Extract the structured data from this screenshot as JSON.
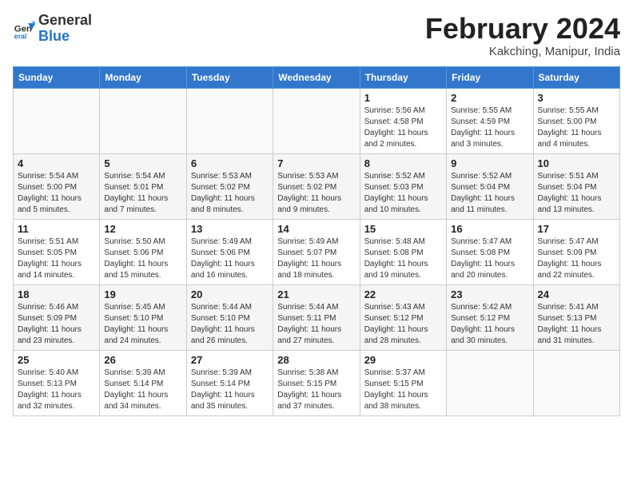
{
  "header": {
    "logo_general": "General",
    "logo_blue": "Blue",
    "month_title": "February 2024",
    "location": "Kakching, Manipur, India"
  },
  "weekdays": [
    "Sunday",
    "Monday",
    "Tuesday",
    "Wednesday",
    "Thursday",
    "Friday",
    "Saturday"
  ],
  "weeks": [
    [
      {
        "day": "",
        "info": ""
      },
      {
        "day": "",
        "info": ""
      },
      {
        "day": "",
        "info": ""
      },
      {
        "day": "",
        "info": ""
      },
      {
        "day": "1",
        "info": "Sunrise: 5:56 AM\nSunset: 4:58 PM\nDaylight: 11 hours\nand 2 minutes."
      },
      {
        "day": "2",
        "info": "Sunrise: 5:55 AM\nSunset: 4:59 PM\nDaylight: 11 hours\nand 3 minutes."
      },
      {
        "day": "3",
        "info": "Sunrise: 5:55 AM\nSunset: 5:00 PM\nDaylight: 11 hours\nand 4 minutes."
      }
    ],
    [
      {
        "day": "4",
        "info": "Sunrise: 5:54 AM\nSunset: 5:00 PM\nDaylight: 11 hours\nand 5 minutes."
      },
      {
        "day": "5",
        "info": "Sunrise: 5:54 AM\nSunset: 5:01 PM\nDaylight: 11 hours\nand 7 minutes."
      },
      {
        "day": "6",
        "info": "Sunrise: 5:53 AM\nSunset: 5:02 PM\nDaylight: 11 hours\nand 8 minutes."
      },
      {
        "day": "7",
        "info": "Sunrise: 5:53 AM\nSunset: 5:02 PM\nDaylight: 11 hours\nand 9 minutes."
      },
      {
        "day": "8",
        "info": "Sunrise: 5:52 AM\nSunset: 5:03 PM\nDaylight: 11 hours\nand 10 minutes."
      },
      {
        "day": "9",
        "info": "Sunrise: 5:52 AM\nSunset: 5:04 PM\nDaylight: 11 hours\nand 11 minutes."
      },
      {
        "day": "10",
        "info": "Sunrise: 5:51 AM\nSunset: 5:04 PM\nDaylight: 11 hours\nand 13 minutes."
      }
    ],
    [
      {
        "day": "11",
        "info": "Sunrise: 5:51 AM\nSunset: 5:05 PM\nDaylight: 11 hours\nand 14 minutes."
      },
      {
        "day": "12",
        "info": "Sunrise: 5:50 AM\nSunset: 5:06 PM\nDaylight: 11 hours\nand 15 minutes."
      },
      {
        "day": "13",
        "info": "Sunrise: 5:49 AM\nSunset: 5:06 PM\nDaylight: 11 hours\nand 16 minutes."
      },
      {
        "day": "14",
        "info": "Sunrise: 5:49 AM\nSunset: 5:07 PM\nDaylight: 11 hours\nand 18 minutes."
      },
      {
        "day": "15",
        "info": "Sunrise: 5:48 AM\nSunset: 5:08 PM\nDaylight: 11 hours\nand 19 minutes."
      },
      {
        "day": "16",
        "info": "Sunrise: 5:47 AM\nSunset: 5:08 PM\nDaylight: 11 hours\nand 20 minutes."
      },
      {
        "day": "17",
        "info": "Sunrise: 5:47 AM\nSunset: 5:09 PM\nDaylight: 11 hours\nand 22 minutes."
      }
    ],
    [
      {
        "day": "18",
        "info": "Sunrise: 5:46 AM\nSunset: 5:09 PM\nDaylight: 11 hours\nand 23 minutes."
      },
      {
        "day": "19",
        "info": "Sunrise: 5:45 AM\nSunset: 5:10 PM\nDaylight: 11 hours\nand 24 minutes."
      },
      {
        "day": "20",
        "info": "Sunrise: 5:44 AM\nSunset: 5:10 PM\nDaylight: 11 hours\nand 26 minutes."
      },
      {
        "day": "21",
        "info": "Sunrise: 5:44 AM\nSunset: 5:11 PM\nDaylight: 11 hours\nand 27 minutes."
      },
      {
        "day": "22",
        "info": "Sunrise: 5:43 AM\nSunset: 5:12 PM\nDaylight: 11 hours\nand 28 minutes."
      },
      {
        "day": "23",
        "info": "Sunrise: 5:42 AM\nSunset: 5:12 PM\nDaylight: 11 hours\nand 30 minutes."
      },
      {
        "day": "24",
        "info": "Sunrise: 5:41 AM\nSunset: 5:13 PM\nDaylight: 11 hours\nand 31 minutes."
      }
    ],
    [
      {
        "day": "25",
        "info": "Sunrise: 5:40 AM\nSunset: 5:13 PM\nDaylight: 11 hours\nand 32 minutes."
      },
      {
        "day": "26",
        "info": "Sunrise: 5:39 AM\nSunset: 5:14 PM\nDaylight: 11 hours\nand 34 minutes."
      },
      {
        "day": "27",
        "info": "Sunrise: 5:39 AM\nSunset: 5:14 PM\nDaylight: 11 hours\nand 35 minutes."
      },
      {
        "day": "28",
        "info": "Sunrise: 5:38 AM\nSunset: 5:15 PM\nDaylight: 11 hours\nand 37 minutes."
      },
      {
        "day": "29",
        "info": "Sunrise: 5:37 AM\nSunset: 5:15 PM\nDaylight: 11 hours\nand 38 minutes."
      },
      {
        "day": "",
        "info": ""
      },
      {
        "day": "",
        "info": ""
      }
    ]
  ]
}
